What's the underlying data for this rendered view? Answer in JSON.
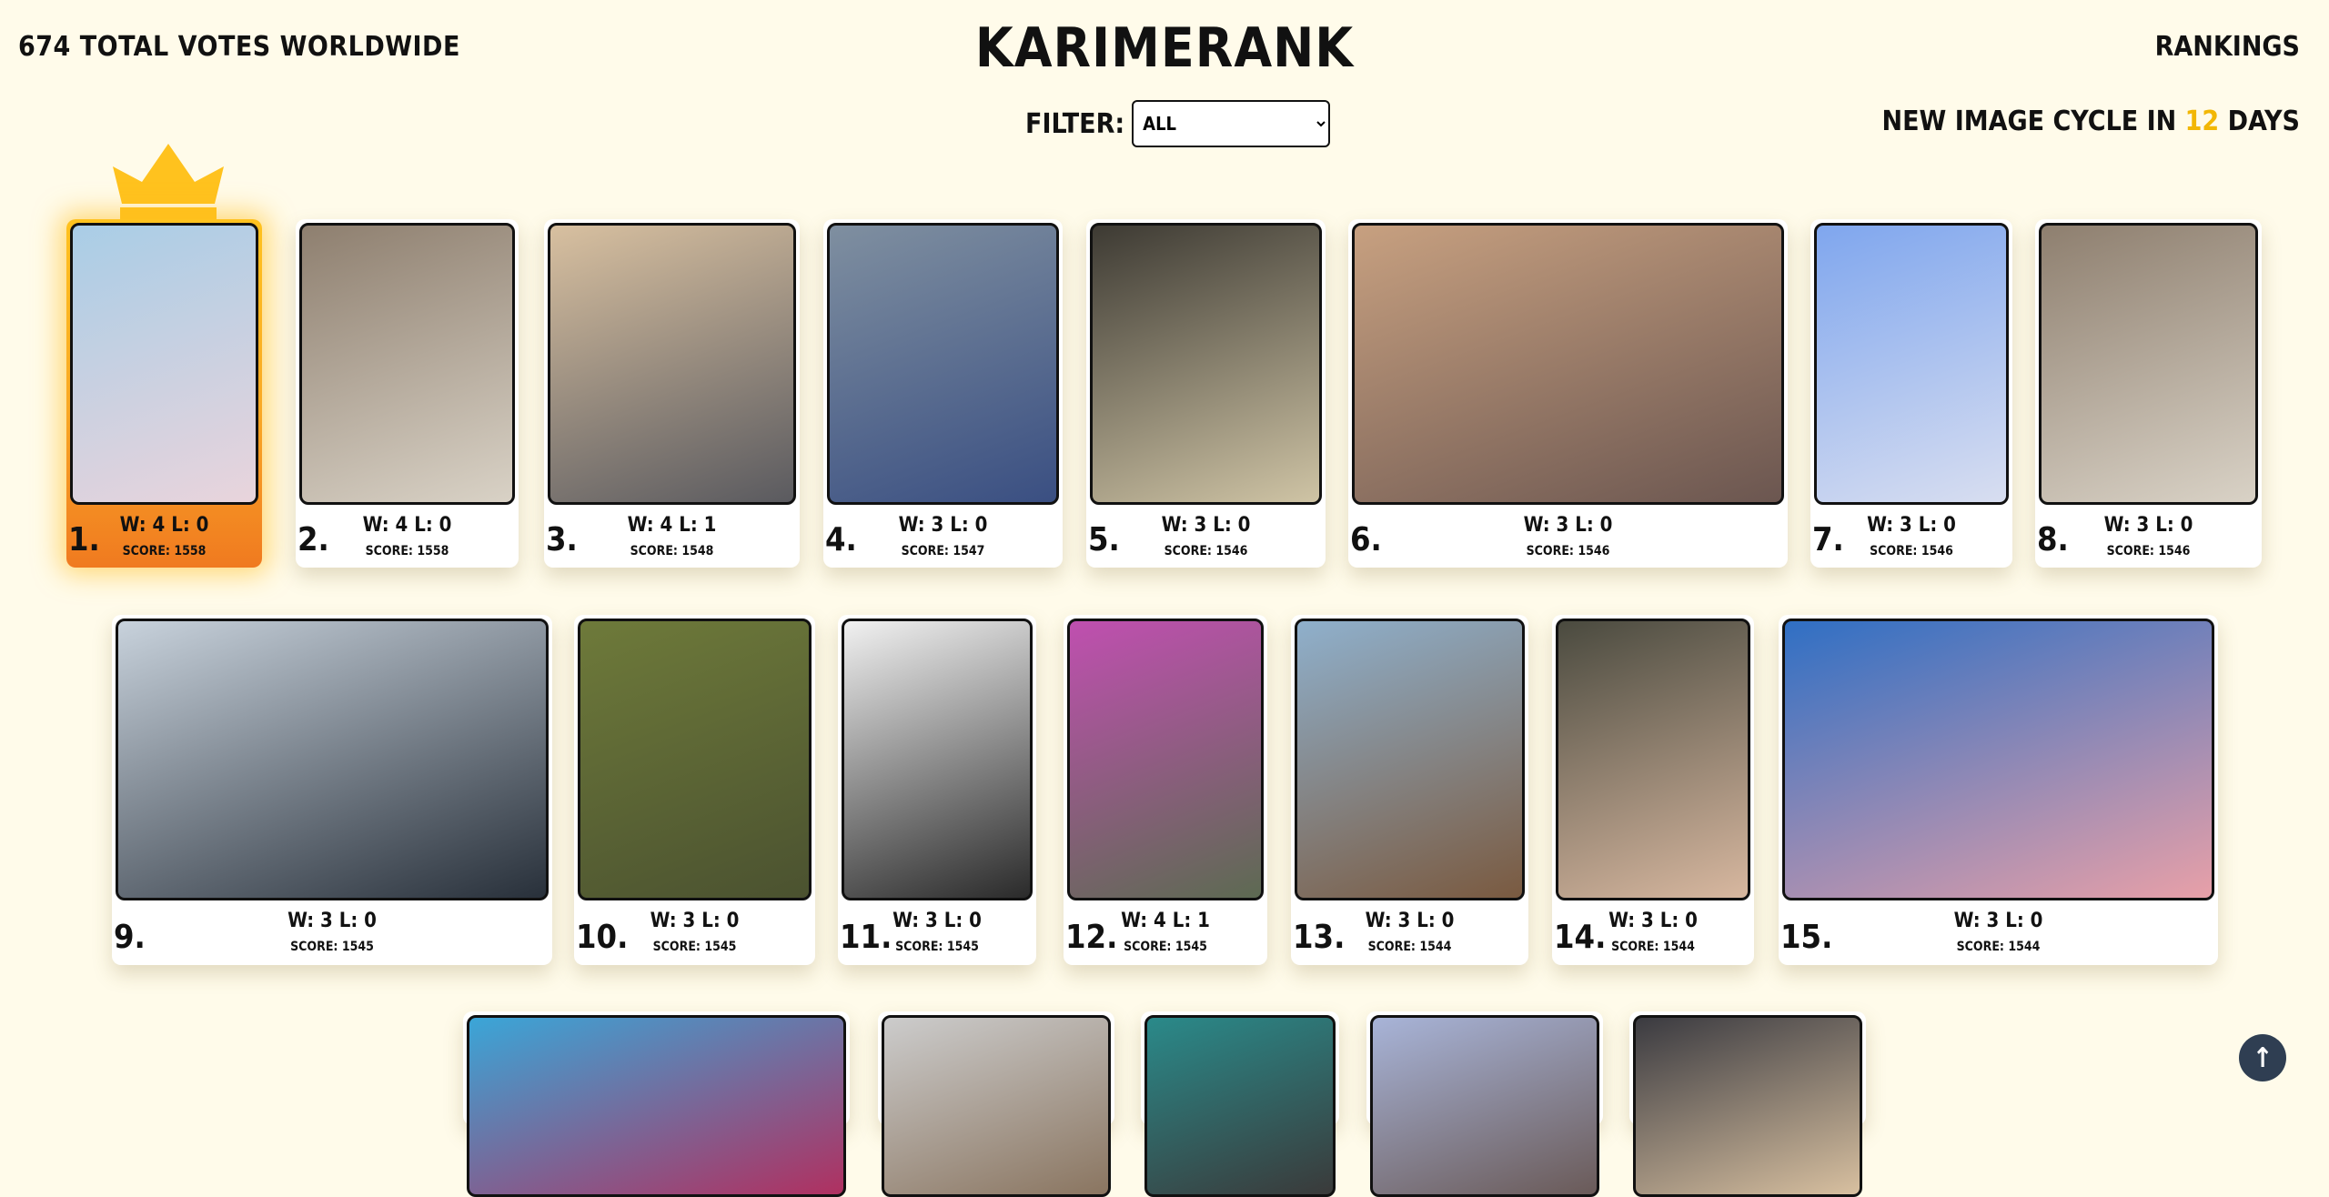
{
  "header": {
    "total_votes": "674 TOTAL VOTES WORLDWIDE",
    "title": "KARIMERANK",
    "rankings_link": "RANKINGS"
  },
  "filter": {
    "label": "FILTER:",
    "selected": "ALL"
  },
  "cycle": {
    "prefix": "NEW IMAGE CYCLE IN ",
    "days": "12",
    "suffix": " DAYS"
  },
  "cards": [
    {
      "rank": "1.",
      "record": "W: 4 L: 0",
      "score": "SCORE: 1558",
      "colors": [
        "#a9cde6",
        "#e9d4dc"
      ]
    },
    {
      "rank": "2.",
      "record": "W: 4 L: 0",
      "score": "SCORE: 1558",
      "colors": [
        "#8e7f6f",
        "#d9d2c6"
      ]
    },
    {
      "rank": "3.",
      "record": "W: 4 L: 1",
      "score": "SCORE: 1548",
      "colors": [
        "#d8c0a0",
        "#5a5a5f"
      ]
    },
    {
      "rank": "4.",
      "record": "W: 3 L: 0",
      "score": "SCORE: 1547",
      "colors": [
        "#7f8fa0",
        "#3a4f82"
      ]
    },
    {
      "rank": "5.",
      "record": "W: 3 L: 0",
      "score": "SCORE: 1546",
      "colors": [
        "#3d3a33",
        "#cfc4a5"
      ]
    },
    {
      "rank": "6.",
      "record": "W: 3 L: 0",
      "score": "SCORE: 1546",
      "colors": [
        "#c7a080",
        "#6b5650"
      ]
    },
    {
      "rank": "7.",
      "record": "W: 3 L: 0",
      "score": "SCORE: 1546",
      "colors": [
        "#7fa6ee",
        "#d8def0"
      ]
    },
    {
      "rank": "8.",
      "record": "W: 3 L: 0",
      "score": "SCORE: 1546",
      "colors": [
        "#8e7f6f",
        "#d9d2c6"
      ]
    },
    {
      "rank": "9.",
      "record": "W: 3 L: 0",
      "score": "SCORE: 1545",
      "colors": [
        "#c8d2dc",
        "#28303a"
      ]
    },
    {
      "rank": "10.",
      "record": "W: 3 L: 0",
      "score": "SCORE: 1545",
      "colors": [
        "#6e7a3a",
        "#4b5230"
      ]
    },
    {
      "rank": "11.",
      "record": "W: 3 L: 0",
      "score": "SCORE: 1545",
      "colors": [
        "#f1f1f1",
        "#2a2a2a"
      ]
    },
    {
      "rank": "12.",
      "record": "W: 4 L: 1",
      "score": "SCORE: 1545",
      "colors": [
        "#c04fb0",
        "#5d6a52"
      ]
    },
    {
      "rank": "13.",
      "record": "W: 3 L: 0",
      "score": "SCORE: 1544",
      "colors": [
        "#8fb0cc",
        "#7a5a40"
      ]
    },
    {
      "rank": "14.",
      "record": "W: 3 L: 0",
      "score": "SCORE: 1544",
      "colors": [
        "#4a4a3f",
        "#d8b8a0"
      ]
    },
    {
      "rank": "15.",
      "record": "W: 3 L: 0",
      "score": "SCORE: 1544",
      "colors": [
        "#2f6fc4",
        "#e8a0a8"
      ]
    }
  ],
  "partial_cards": [
    {
      "colors": [
        "#3aa6d8",
        "#b03060"
      ]
    },
    {
      "colors": [
        "#cccccc",
        "#8a7560"
      ]
    },
    {
      "colors": [
        "#2a8a8a",
        "#3a3a3a"
      ]
    },
    {
      "colors": [
        "#a8b4d8",
        "#6a5a58"
      ]
    },
    {
      "colors": [
        "#3a3a40",
        "#d8c0a0"
      ]
    }
  ],
  "scroll_top_icon": "arrow-up-icon",
  "crown_icon": "crown-icon",
  "accent_color": "#f2b705"
}
